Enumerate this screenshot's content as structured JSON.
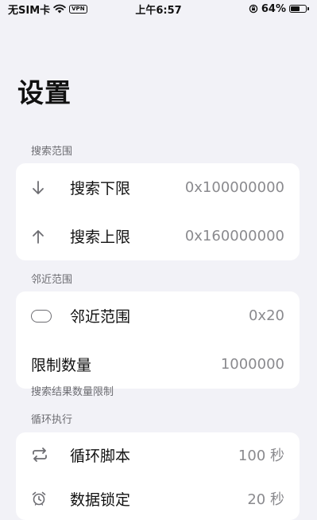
{
  "status": {
    "carrier": "无SIM卡",
    "vpn": "VPN",
    "time": "上午6:57",
    "battery_text": "64%",
    "battery_level": 0.64
  },
  "page_title": "设置",
  "sections": {
    "search_range": {
      "header": "搜索范围",
      "items": [
        {
          "label": "搜索下限",
          "value": "0x100000000",
          "icon": "arrow-down-icon"
        },
        {
          "label": "搜索上限",
          "value": "0x160000000",
          "icon": "arrow-up-icon"
        }
      ]
    },
    "proximity": {
      "header": "邻近范围",
      "items": [
        {
          "label": "邻近范围",
          "value": "0x20",
          "icon": "oval-icon"
        },
        {
          "label": "限制数量",
          "value": "1000000"
        }
      ],
      "footer": "搜索结果数量限制"
    },
    "loop": {
      "header": "循环执行",
      "items": [
        {
          "label": "循环脚本",
          "value": "100 秒",
          "icon": "repeat-icon"
        },
        {
          "label": "数据锁定",
          "value": "20 秒",
          "icon": "alarm-clock-icon"
        }
      ]
    }
  }
}
